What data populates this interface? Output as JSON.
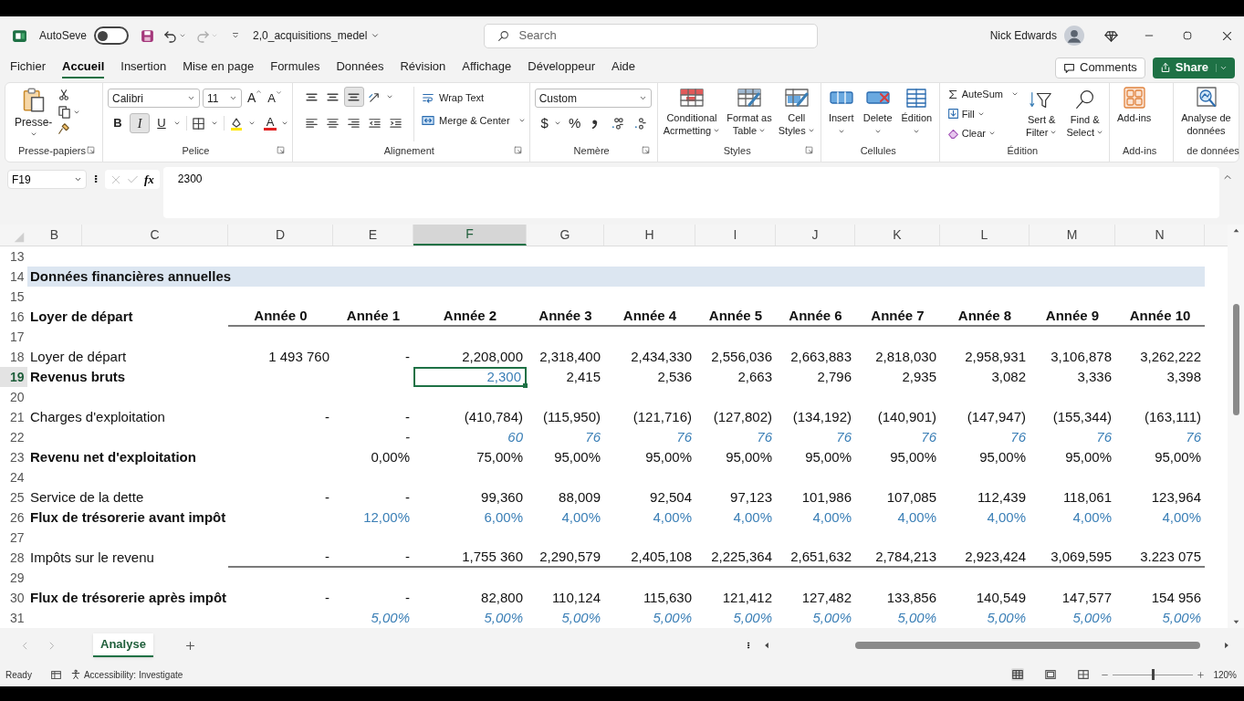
{
  "title_bar": {
    "autosave_label": "AutoSeve",
    "autosave_on": false,
    "file_name": "2,0_acquisitions_medel",
    "search_placeholder": "Search",
    "user_name": "Nick Edwards"
  },
  "menu_tabs": [
    {
      "label": "Fichier",
      "selected": false
    },
    {
      "label": "Accueil",
      "selected": true
    },
    {
      "label": "Insertion",
      "selected": false
    },
    {
      "label": "Mise en page",
      "selected": false
    },
    {
      "label": "Formules",
      "selected": false
    },
    {
      "label": "Données",
      "selected": false
    },
    {
      "label": "Révision",
      "selected": false
    },
    {
      "label": "Affichage",
      "selected": false
    },
    {
      "label": "Développeur",
      "selected": false
    },
    {
      "label": "Aide",
      "selected": false
    }
  ],
  "comments_button": "Comments",
  "share_button": "Share",
  "ribbon": {
    "clipboard": {
      "paste": "Presse-",
      "label": "Presse-papiers"
    },
    "font": {
      "font_name": "Calibri",
      "font_size": "11",
      "grow": "A",
      "shrink": "A",
      "bold": {
        "text": "B",
        "on": false
      },
      "italic": {
        "text": "I",
        "on": true
      },
      "underline": {
        "text": "U",
        "on": false
      },
      "font_color": "A",
      "label": "Pelice"
    },
    "alignment": {
      "bottom_align_on": true,
      "wrap_text": "Wrap Text",
      "merge_center": "Merge & Center",
      "label": "Alignement"
    },
    "number": {
      "format": "Custom",
      "currency": "$",
      "percent": "%",
      "label": "Nemère"
    },
    "styles": {
      "buttons": [
        [
          "Conditional",
          "Acrmetting"
        ],
        [
          "Format as",
          "Table"
        ],
        [
          "Cell",
          "Styles"
        ]
      ],
      "label": "Styles"
    },
    "cells": {
      "buttons": [
        "Insert",
        "Delete",
        "Édition"
      ],
      "label": "Cellules"
    },
    "editing": {
      "autosum": "AuteSum",
      "fill": "Fill",
      "clear": "Clear",
      "sort": [
        "Sert &",
        "Filter"
      ],
      "find": [
        "Find &",
        "Select"
      ],
      "label": "Édition"
    },
    "addins": {
      "button": "Add-ins",
      "label": "Add-ins"
    },
    "analysis": {
      "button": [
        "Analyse de",
        "données"
      ],
      "label": "de données"
    }
  },
  "formula_bar": {
    "name_box": "F19",
    "function_label": "fx",
    "formula": "2300"
  },
  "columns": [
    {
      "label": "B",
      "selected": false
    },
    {
      "label": "C",
      "selected": false
    },
    {
      "label": "D",
      "selected": false
    },
    {
      "label": "E",
      "selected": false
    },
    {
      "label": "F",
      "selected": true
    },
    {
      "label": "G",
      "selected": false
    },
    {
      "label": "H",
      "selected": false
    },
    {
      "label": "I",
      "selected": false
    },
    {
      "label": "J",
      "selected": false
    },
    {
      "label": "K",
      "selected": false
    },
    {
      "label": "L",
      "selected": false
    },
    {
      "label": "M",
      "selected": false
    },
    {
      "label": "N",
      "selected": false
    }
  ],
  "rows": [
    {
      "number": "13",
      "kind": "blank",
      "selected": false
    },
    {
      "number": "14",
      "kind": "band",
      "selected": false,
      "label": "Données financières annuelles",
      "bold": true,
      "italic": false
    },
    {
      "number": "15",
      "kind": "blank",
      "selected": false
    },
    {
      "number": "16",
      "kind": "data",
      "selected": false,
      "label": "Loyer de départ",
      "bold": true,
      "italic": false,
      "rule_below": true,
      "cells": [
        {
          "text": "Année 0",
          "kind": "header"
        },
        {
          "text": "Année 1",
          "kind": "header"
        },
        {
          "text": "Année 2",
          "kind": "header"
        },
        {
          "text": "Année 3",
          "kind": "header"
        },
        {
          "text": "Année 4",
          "kind": "header"
        },
        {
          "text": "Année 5",
          "kind": "header"
        },
        {
          "text": "Année 6",
          "kind": "header"
        },
        {
          "text": "Année 7",
          "kind": "header"
        },
        {
          "text": "Année 8",
          "kind": "header"
        },
        {
          "text": "Année 9",
          "kind": "header"
        },
        {
          "text": "Année 10",
          "kind": "header"
        }
      ]
    },
    {
      "number": "17",
      "kind": "blank",
      "selected": false
    },
    {
      "number": "18",
      "kind": "data",
      "selected": false,
      "label": "Loyer de départ",
      "bold": false,
      "italic": false,
      "rule_below": false,
      "cells": [
        {
          "text": "1 493 760",
          "kind": "value"
        },
        {
          "text": "-",
          "kind": "value"
        },
        {
          "text": "2,208,000",
          "kind": "value"
        },
        {
          "text": "2,318,400",
          "kind": "value"
        },
        {
          "text": "2,434,330",
          "kind": "value"
        },
        {
          "text": "2,556,036",
          "kind": "value"
        },
        {
          "text": "2,663,883",
          "kind": "value"
        },
        {
          "text": "2,818,030",
          "kind": "value"
        },
        {
          "text": "2,958,931",
          "kind": "value"
        },
        {
          "text": "3,106,878",
          "kind": "value"
        },
        {
          "text": "3,262,222",
          "kind": "value"
        }
      ]
    },
    {
      "number": "19",
      "kind": "data",
      "selected": true,
      "label": "Revenus bruts",
      "bold": true,
      "italic": false,
      "rule_below": false,
      "cells": [
        null,
        null,
        {
          "text": "2,300",
          "kind": "input"
        },
        {
          "text": "2,415",
          "kind": "value"
        },
        {
          "text": "2,536",
          "kind": "value"
        },
        {
          "text": "2,663",
          "kind": "value"
        },
        {
          "text": "2,796",
          "kind": "value"
        },
        {
          "text": "2,935",
          "kind": "value"
        },
        {
          "text": "3,082",
          "kind": "value"
        },
        {
          "text": "3,336",
          "kind": "value"
        },
        {
          "text": "3,398",
          "kind": "value"
        }
      ]
    },
    {
      "number": "20",
      "kind": "blank",
      "selected": false
    },
    {
      "number": "21",
      "kind": "data",
      "selected": false,
      "label": "Charges d'exploitation",
      "bold": false,
      "italic": false,
      "rule_below": false,
      "cells": [
        {
          "text": "-",
          "kind": "value"
        },
        {
          "text": "-",
          "kind": "value"
        },
        {
          "text": "(410,784)",
          "kind": "value"
        },
        {
          "text": "(115,950)",
          "kind": "value"
        },
        {
          "text": "(121,716)",
          "kind": "value"
        },
        {
          "text": "(127,802)",
          "kind": "value"
        },
        {
          "text": "(134,192)",
          "kind": "value"
        },
        {
          "text": "(140,901)",
          "kind": "value"
        },
        {
          "text": "(147,947)",
          "kind": "value"
        },
        {
          "text": "(155,344)",
          "kind": "value"
        },
        {
          "text": "(163,111)",
          "kind": "value"
        }
      ]
    },
    {
      "number": "22",
      "kind": "data",
      "selected": false,
      "italic": true,
      "rule_below": false,
      "cells": [
        null,
        {
          "text": "-",
          "kind": "value"
        },
        {
          "text": "60",
          "kind": "input"
        },
        {
          "text": "76",
          "kind": "input"
        },
        {
          "text": "76",
          "kind": "input"
        },
        {
          "text": "76",
          "kind": "input"
        },
        {
          "text": "76",
          "kind": "input"
        },
        {
          "text": "76",
          "kind": "input"
        },
        {
          "text": "76",
          "kind": "input"
        },
        {
          "text": "76",
          "kind": "input"
        },
        {
          "text": "76",
          "kind": "input"
        }
      ]
    },
    {
      "number": "23",
      "kind": "data",
      "selected": false,
      "label": "Revenu net d'exploitation",
      "bold": true,
      "italic": false,
      "rule_below": false,
      "cells": [
        null,
        {
          "text": "0,00%",
          "kind": "value"
        },
        {
          "text": "75,00%",
          "kind": "value"
        },
        {
          "text": "95,00%",
          "kind": "value"
        },
        {
          "text": "95,00%",
          "kind": "value"
        },
        {
          "text": "95,00%",
          "kind": "value"
        },
        {
          "text": "95,00%",
          "kind": "value"
        },
        {
          "text": "95,00%",
          "kind": "value"
        },
        {
          "text": "95,00%",
          "kind": "value"
        },
        {
          "text": "95,00%",
          "kind": "value"
        },
        {
          "text": "95,00%",
          "kind": "value"
        }
      ]
    },
    {
      "number": "24",
      "kind": "blank",
      "selected": false
    },
    {
      "number": "25",
      "kind": "data",
      "selected": false,
      "label": "Service de la dette",
      "bold": false,
      "italic": false,
      "rule_below": false,
      "cells": [
        {
          "text": "-",
          "kind": "value"
        },
        {
          "text": "-",
          "kind": "value"
        },
        {
          "text": "99,360",
          "kind": "value"
        },
        {
          "text": "88,009",
          "kind": "value"
        },
        {
          "text": "92,504",
          "kind": "value"
        },
        {
          "text": "97,123",
          "kind": "value"
        },
        {
          "text": "101,986",
          "kind": "value"
        },
        {
          "text": "107,085",
          "kind": "value"
        },
        {
          "text": "112,439",
          "kind": "value"
        },
        {
          "text": "118,061",
          "kind": "value"
        },
        {
          "text": "123,964",
          "kind": "value"
        }
      ]
    },
    {
      "number": "26",
      "kind": "data",
      "selected": false,
      "label": "Flux de trésorerie avant impôt",
      "bold": true,
      "italic": false,
      "rule_below": false,
      "cells": [
        null,
        {
          "text": "12,00%",
          "kind": "input"
        },
        {
          "text": "6,00%",
          "kind": "input"
        },
        {
          "text": "4,00%",
          "kind": "input"
        },
        {
          "text": "4,00%",
          "kind": "input"
        },
        {
          "text": "4,00%",
          "kind": "input"
        },
        {
          "text": "4,00%",
          "kind": "input"
        },
        {
          "text": "4,00%",
          "kind": "input"
        },
        {
          "text": "4,00%",
          "kind": "input"
        },
        {
          "text": "4,00%",
          "kind": "input"
        },
        {
          "text": "4,00%",
          "kind": "input"
        }
      ]
    },
    {
      "number": "27",
      "kind": "blank",
      "selected": false
    },
    {
      "number": "28",
      "kind": "data",
      "selected": false,
      "label": "Impôts sur le revenu",
      "bold": false,
      "italic": false,
      "rule_below": true,
      "cells": [
        {
          "text": "-",
          "kind": "value"
        },
        {
          "text": "-",
          "kind": "value"
        },
        {
          "text": "1,755 360",
          "kind": "value"
        },
        {
          "text": "2,290,579",
          "kind": "value"
        },
        {
          "text": "2,405,108",
          "kind": "value"
        },
        {
          "text": "2,225,364",
          "kind": "value"
        },
        {
          "text": "2,651,632",
          "kind": "value"
        },
        {
          "text": "2,784,213",
          "kind": "value"
        },
        {
          "text": "2,923,424",
          "kind": "value"
        },
        {
          "text": "3,069,595",
          "kind": "value"
        },
        {
          "text": "3.223 075",
          "kind": "value"
        }
      ]
    },
    {
      "number": "29",
      "kind": "blank",
      "selected": false
    },
    {
      "number": "30",
      "kind": "data",
      "selected": false,
      "label": "Flux de trésorerie après impôt",
      "bold": true,
      "italic": false,
      "rule_below": false,
      "cells": [
        {
          "text": "-",
          "kind": "value"
        },
        {
          "text": "-",
          "kind": "value"
        },
        {
          "text": "82,800",
          "kind": "value"
        },
        {
          "text": "110,124",
          "kind": "value"
        },
        {
          "text": "115,630",
          "kind": "value"
        },
        {
          "text": "121,412",
          "kind": "value"
        },
        {
          "text": "127,482",
          "kind": "value"
        },
        {
          "text": "133,856",
          "kind": "value"
        },
        {
          "text": "140,549",
          "kind": "value"
        },
        {
          "text": "147,577",
          "kind": "value"
        },
        {
          "text": "154 956",
          "kind": "value"
        }
      ]
    },
    {
      "number": "31",
      "kind": "data",
      "selected": false,
      "italic": true,
      "rule_below": false,
      "cells": [
        null,
        {
          "text": "5,00%",
          "kind": "input"
        },
        {
          "text": "5,00%",
          "kind": "input"
        },
        {
          "text": "5,00%",
          "kind": "input"
        },
        {
          "text": "5,00%",
          "kind": "input"
        },
        {
          "text": "5,00%",
          "kind": "input"
        },
        {
          "text": "5,00%",
          "kind": "input"
        },
        {
          "text": "5,00%",
          "kind": "input"
        },
        {
          "text": "5,00%",
          "kind": "input"
        },
        {
          "text": "5,00%",
          "kind": "input"
        },
        {
          "text": "5,00%",
          "kind": "input"
        }
      ]
    }
  ],
  "sheet_tabs": [
    {
      "label": "Analyse",
      "selected": true
    }
  ],
  "status_bar": {
    "ready": "Ready",
    "accessibility": "Accessibility: Investigate",
    "zoom": "120%",
    "zoom_level": {
      "level": 0.5
    }
  }
}
